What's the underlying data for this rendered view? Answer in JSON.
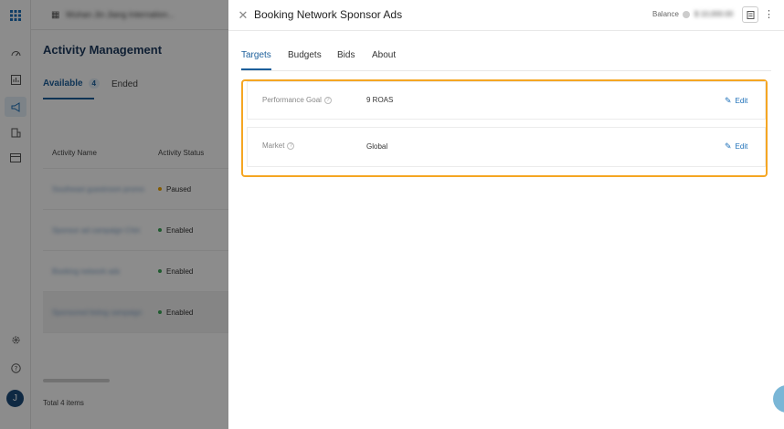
{
  "left_rail": {
    "icons": [
      "apps-grid-icon",
      "dashboard-icon",
      "report-icon",
      "campaign-icon",
      "building-icon",
      "billing-icon",
      "settings-icon",
      "help-icon"
    ],
    "avatar_initial": "J"
  },
  "topbar": {
    "company": "Wuhan Jin Jiang Internation..."
  },
  "main": {
    "title": "Activity Management",
    "tabs": {
      "available": "Available",
      "available_count": "4",
      "ended": "Ended"
    },
    "table": {
      "headers": {
        "name": "Activity Name",
        "status": "Activity Status"
      },
      "rows": [
        {
          "name": "Southeast guestroom promo",
          "status": "Paused"
        },
        {
          "name": "Sponsor ad campaign Chin",
          "status": "Enabled"
        },
        {
          "name": "Booking network ads",
          "status": "Enabled"
        },
        {
          "name": "Sponsored listing campaign",
          "status": "Enabled"
        }
      ]
    },
    "footer_total": "Total 4 items"
  },
  "drawer": {
    "title": "Booking Network Sponsor Ads",
    "balance_label": "Balance",
    "balance_value": "$ 10,000.00",
    "tabs": [
      "Targets",
      "Budgets",
      "Bids",
      "About"
    ],
    "rows": [
      {
        "label": "Performance Goal",
        "value": "9 ROAS",
        "edit": "Edit"
      },
      {
        "label": "Market",
        "value": "Global",
        "edit": "Edit"
      }
    ]
  },
  "colors": {
    "accent": "#1c5f9b",
    "highlight": "#f5a623",
    "paused": "#f0a500",
    "enabled": "#3aa757"
  }
}
